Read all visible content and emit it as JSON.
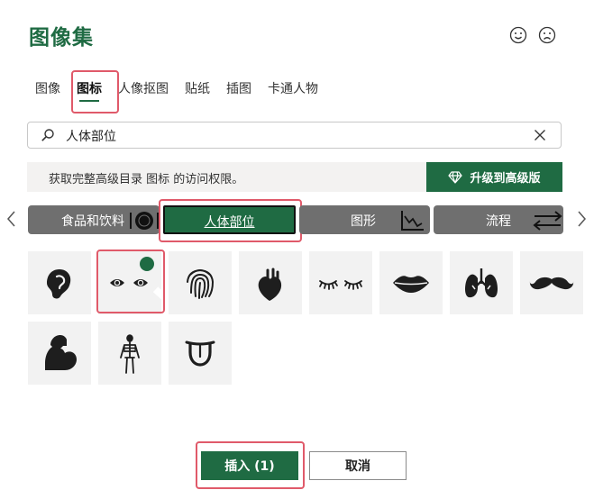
{
  "dialog": {
    "title": "图像集"
  },
  "tabs": [
    {
      "label": "图像"
    },
    {
      "label": "图标"
    },
    {
      "label": "人像抠图"
    },
    {
      "label": "贴纸"
    },
    {
      "label": "插图"
    },
    {
      "label": "卡通人物"
    }
  ],
  "active_tab": "图标",
  "search": {
    "value": "人体部位"
  },
  "banner": {
    "text": "获取完整高级目录 图标 的访问权限。",
    "upgrade_label": "升级到高级版"
  },
  "categories": [
    {
      "label": "食品和饮料"
    },
    {
      "label": "人体部位"
    },
    {
      "label": "图形"
    },
    {
      "label": "流程"
    }
  ],
  "active_category": "人体部位",
  "icons": [
    {
      "name": "ear-icon"
    },
    {
      "name": "eyes-icon",
      "selected": true
    },
    {
      "name": "fingerprint-icon"
    },
    {
      "name": "heart-organ-icon"
    },
    {
      "name": "eyelashes-icon"
    },
    {
      "name": "lips-icon"
    },
    {
      "name": "lungs-icon"
    },
    {
      "name": "mustache-icon"
    },
    {
      "name": "flexed-arm-icon"
    },
    {
      "name": "skeleton-icon"
    },
    {
      "name": "tongue-icon"
    }
  ],
  "footer": {
    "insert_label": "插入 (1)",
    "cancel_label": "取消"
  },
  "colors": {
    "accent": "#1f6b43",
    "category_bg": "#6f6f6f",
    "highlight": "#e05a6a",
    "tile_bg": "#f2f2f2"
  }
}
